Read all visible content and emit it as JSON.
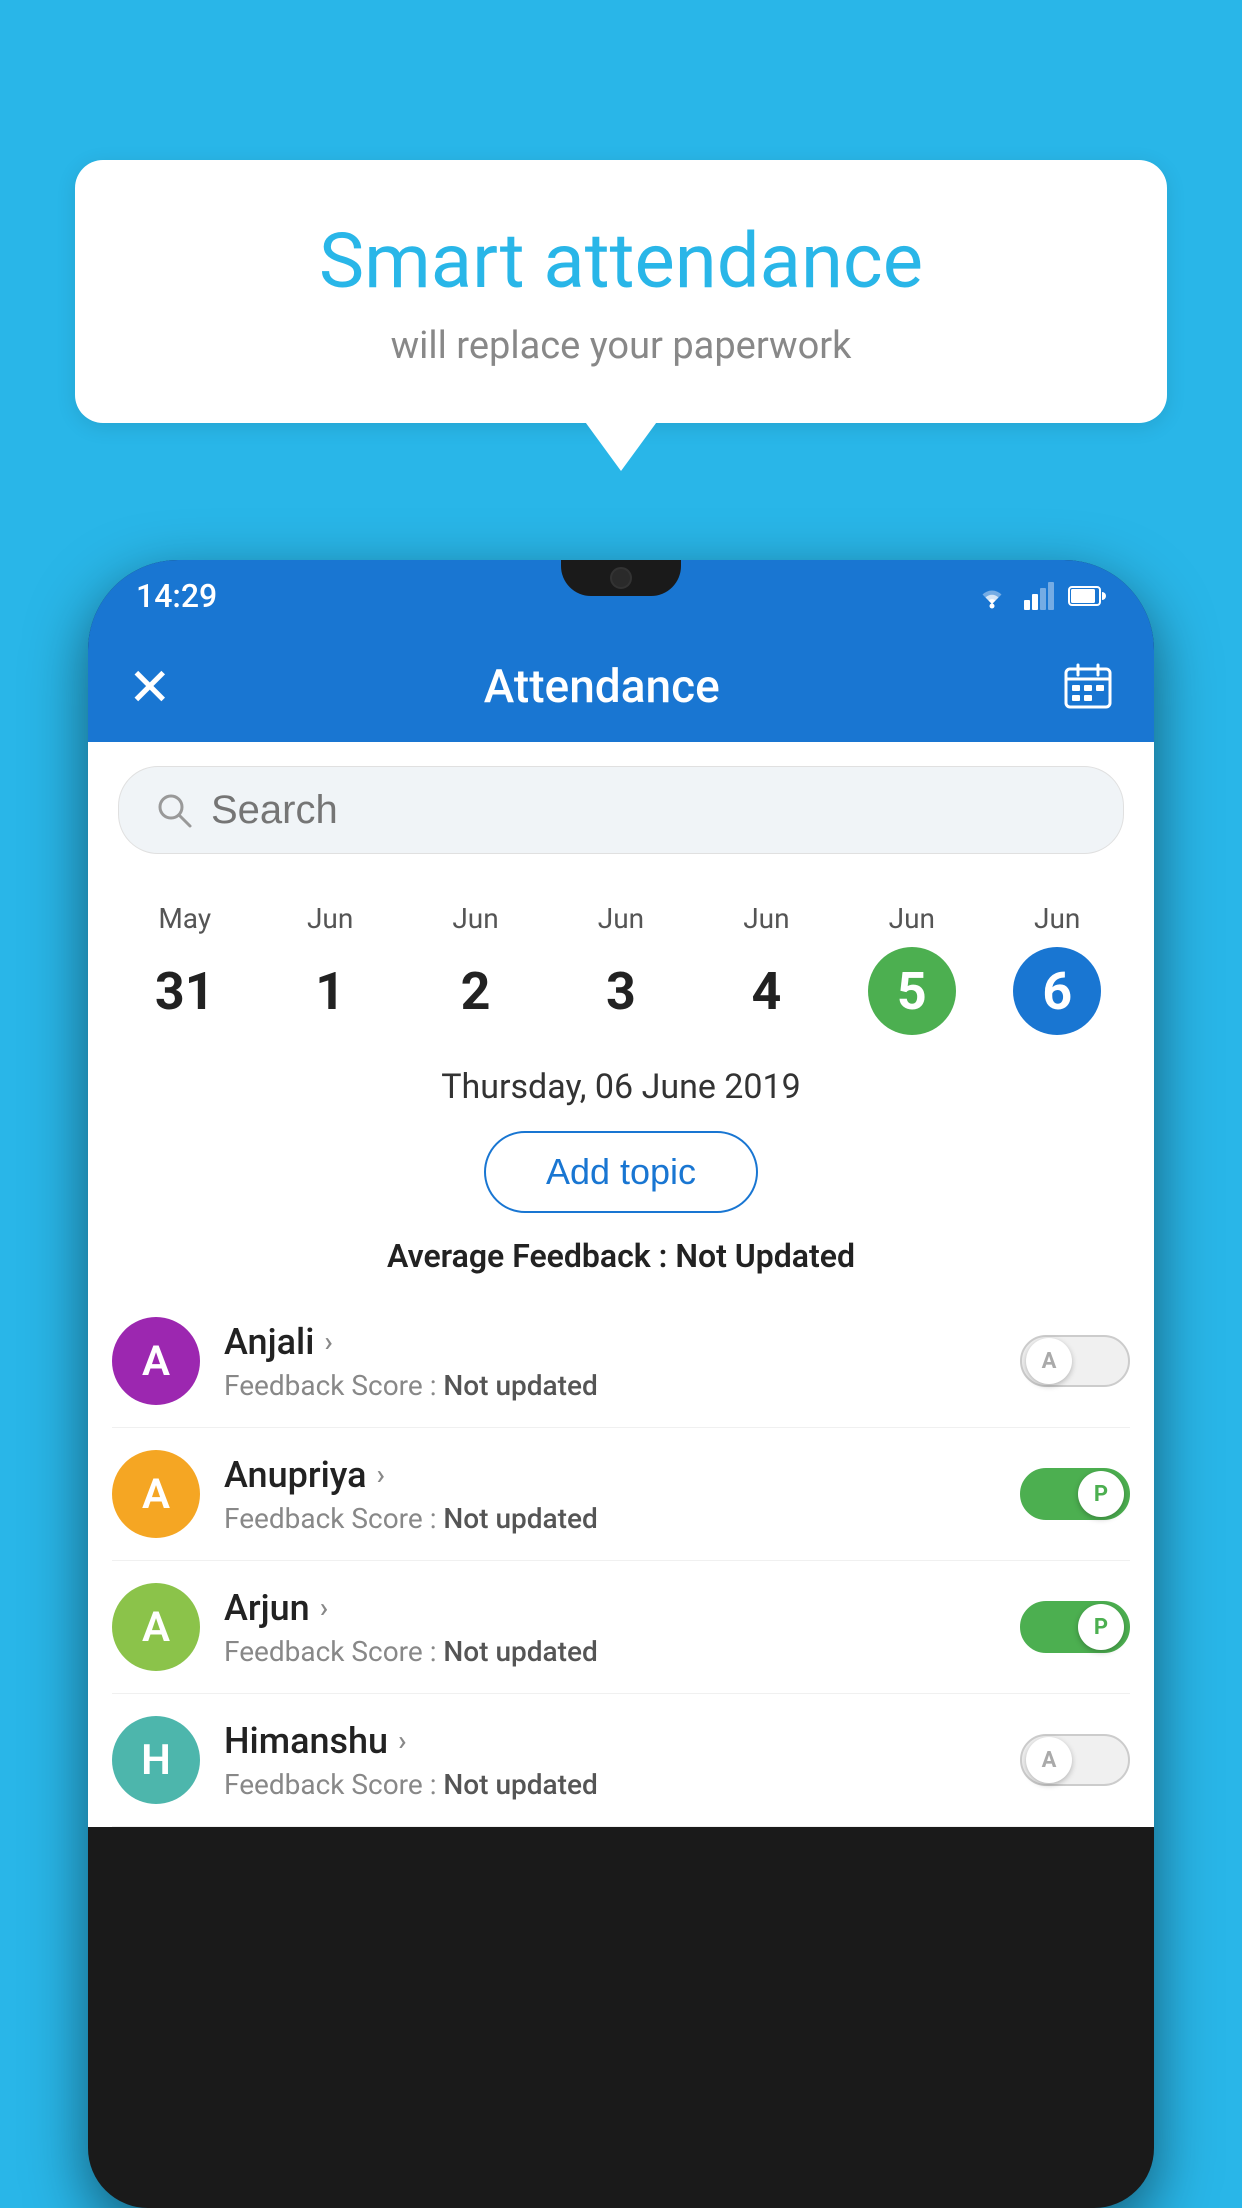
{
  "background_color": "#29b6e8",
  "speech_bubble": {
    "title": "Smart attendance",
    "subtitle": "will replace your paperwork"
  },
  "status_bar": {
    "time": "14:29"
  },
  "app_bar": {
    "title": "Attendance",
    "close_label": "×",
    "calendar_label": "📅"
  },
  "search": {
    "placeholder": "Search"
  },
  "calendar": {
    "days": [
      {
        "month": "May",
        "date": "31",
        "style": "normal"
      },
      {
        "month": "Jun",
        "date": "1",
        "style": "normal"
      },
      {
        "month": "Jun",
        "date": "2",
        "style": "normal"
      },
      {
        "month": "Jun",
        "date": "3",
        "style": "normal"
      },
      {
        "month": "Jun",
        "date": "4",
        "style": "normal"
      },
      {
        "month": "Jun",
        "date": "5",
        "style": "today"
      },
      {
        "month": "Jun",
        "date": "6",
        "style": "selected"
      }
    ]
  },
  "selected_date": "Thursday, 06 June 2019",
  "add_topic_label": "Add topic",
  "avg_feedback": {
    "label": "Average Feedback : ",
    "value": "Not Updated"
  },
  "students": [
    {
      "name": "Anjali",
      "avatar_letter": "A",
      "avatar_color": "purple",
      "feedback_label": "Feedback Score : ",
      "feedback_value": "Not updated",
      "attendance": "absent",
      "toggle_letter": "A"
    },
    {
      "name": "Anupriya",
      "avatar_letter": "A",
      "avatar_color": "yellow",
      "feedback_label": "Feedback Score : ",
      "feedback_value": "Not updated",
      "attendance": "present",
      "toggle_letter": "P"
    },
    {
      "name": "Arjun",
      "avatar_letter": "A",
      "avatar_color": "green",
      "feedback_label": "Feedback Score : ",
      "feedback_value": "Not updated",
      "attendance": "present",
      "toggle_letter": "P"
    },
    {
      "name": "Himanshu",
      "avatar_letter": "H",
      "avatar_color": "teal",
      "feedback_label": "Feedback Score : ",
      "feedback_value": "Not updated",
      "attendance": "absent",
      "toggle_letter": "A"
    }
  ]
}
